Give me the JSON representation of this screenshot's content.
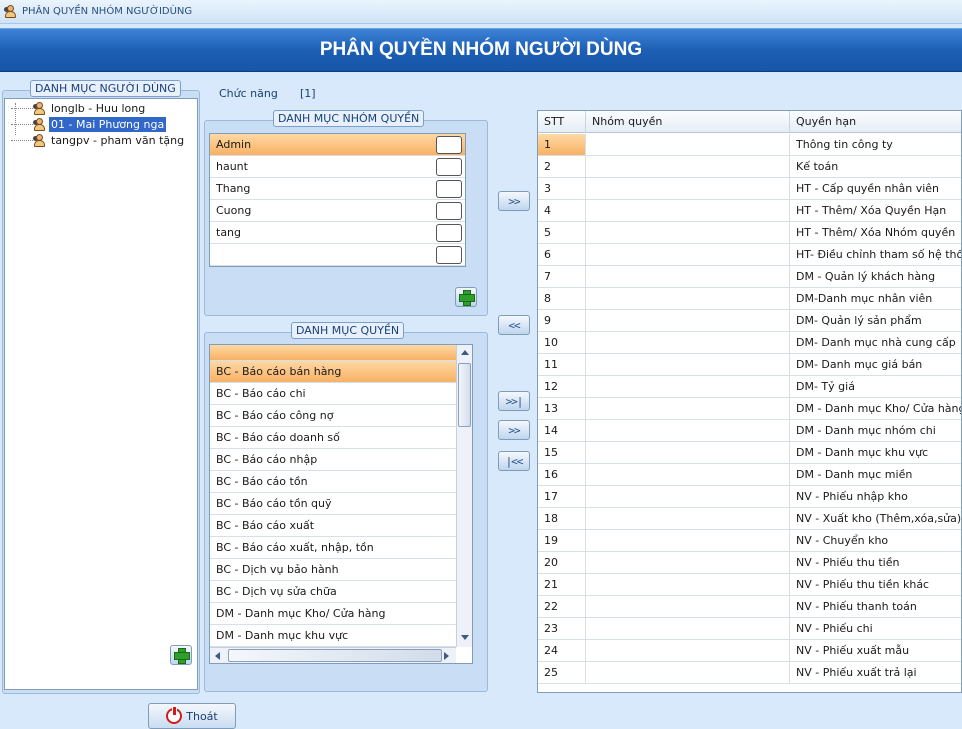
{
  "window": {
    "title": "PHÂN QUYỀN NHÓM NGƯỜIDÙNG"
  },
  "banner": {
    "title": "PHÂN QUYỀN NHÓM NGƯỜI DÙNG"
  },
  "users_panel": {
    "label": "DANH MỤC NGƯỜI DÙNG",
    "items": [
      {
        "label": "longlb - Huu long"
      },
      {
        "label": "01 - Mai Phương nga",
        "selected": true
      },
      {
        "label": "tangpv - pham văn tặng"
      }
    ]
  },
  "function": {
    "label": "Chức năng",
    "value": "[1]"
  },
  "group_panel": {
    "label": "DANH MỤC NHÓM QUYỀN",
    "rows": [
      "Admin",
      "haunt",
      "Thang",
      "Cuong",
      "tang",
      ""
    ]
  },
  "permission_panel": {
    "label": "DANH MỤC QUYỀN",
    "rows": [
      "BC - Báo cáo bán hàng",
      "BC - Báo cáo chi",
      "BC - Báo cáo công nợ",
      "BC - Báo cáo doanh số",
      "BC - Báo cáo nhập",
      "BC - Báo cáo tồn",
      "BC - Báo cáo tồn quỹ",
      "BC - Báo cáo xuất",
      "BC - Báo cáo xuất, nhập, tồn",
      "BC - Dịch vụ bảo hành",
      "BC - Dịch vụ sửa chữa",
      "DM - Danh mục Kho/ Cửa hàng",
      "DM - Danh mục khu vực"
    ]
  },
  "transfer_buttons": [
    ">>",
    "<<",
    ">>|",
    ">>",
    "|<<"
  ],
  "rights_grid": {
    "headers": [
      "STT",
      "Nhóm quyền",
      "Quyền hạn"
    ],
    "rows": [
      [
        "1",
        "",
        "Thông tin công ty"
      ],
      [
        "2",
        "",
        "Kế toán"
      ],
      [
        "3",
        "",
        "HT - Cấp quyền nhân viên"
      ],
      [
        "4",
        "",
        "HT - Thêm/ Xóa Quyền Hạn"
      ],
      [
        "5",
        "",
        "HT - Thêm/ Xóa Nhóm quyền"
      ],
      [
        "6",
        "",
        "HT- Điều chỉnh tham số hệ thống"
      ],
      [
        "7",
        "",
        "DM - Quản lý khách hàng"
      ],
      [
        "8",
        "",
        "DM-Danh mục nhân viên"
      ],
      [
        "9",
        "",
        "DM- Quản lý sản phẩm"
      ],
      [
        "10",
        "",
        "DM- Danh mục nhà cung cấp"
      ],
      [
        "11",
        "",
        "DM- Danh mục giá bán"
      ],
      [
        "12",
        "",
        "DM- Tỷ giá"
      ],
      [
        "13",
        "",
        "DM - Danh mục Kho/ Cửa hàng"
      ],
      [
        "14",
        "",
        "DM - Danh mục nhóm chi"
      ],
      [
        "15",
        "",
        "DM - Danh mục khu vực"
      ],
      [
        "16",
        "",
        "DM - Danh mục miền"
      ],
      [
        "17",
        "",
        "NV - Phiếu nhập kho"
      ],
      [
        "18",
        "",
        "NV - Xuất kho (Thêm,xóa,sửa)"
      ],
      [
        "19",
        "",
        "NV - Chuyển kho"
      ],
      [
        "20",
        "",
        "NV - Phiếu thu tiền"
      ],
      [
        "21",
        "",
        "NV - Phiếu thu tiền khác"
      ],
      [
        "22",
        "",
        "NV - Phiếu thanh toán"
      ],
      [
        "23",
        "",
        "NV - Phiếu chi"
      ],
      [
        "24",
        "",
        "NV - Phiếu xuất mẫu"
      ],
      [
        "25",
        "",
        "NV - Phiếu xuất trả lại"
      ]
    ]
  },
  "footer": {
    "exit_label": "Thoát"
  },
  "icons": {
    "window": "user-group-icon",
    "add": "plus-icon",
    "exit": "power-icon"
  }
}
